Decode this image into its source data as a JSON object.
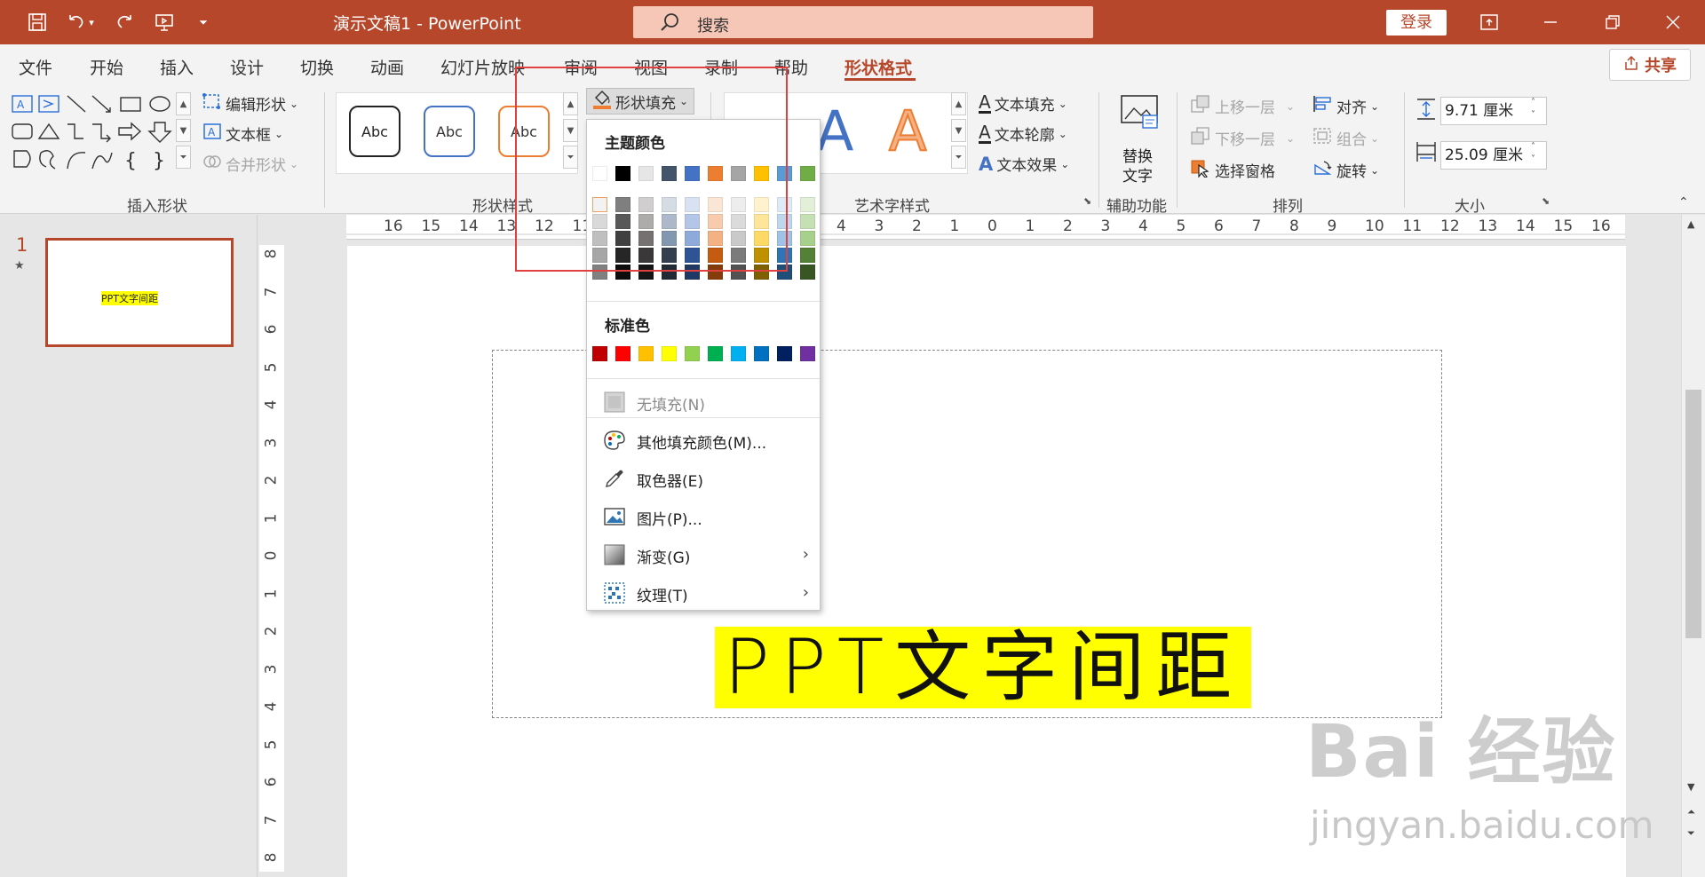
{
  "titlebar": {
    "doc_title": "演示文稿1  -  PowerPoint",
    "search_placeholder": "搜索",
    "login_label": "登录"
  },
  "tabs": [
    "文件",
    "开始",
    "插入",
    "设计",
    "切换",
    "动画",
    "幻灯片放映",
    "审阅",
    "视图",
    "录制",
    "帮助",
    "形状格式"
  ],
  "active_tab": "形状格式",
  "share_label": "共享",
  "ribbon": {
    "insert_shapes": {
      "label": "插入形状",
      "edit_shape": "编辑形状",
      "text_box": "文本框",
      "merge_shapes": "合并形状"
    },
    "shape_styles": {
      "label": "形状样式",
      "style_samples": [
        "Abc",
        "Abc",
        "Abc"
      ],
      "shape_fill": "形状填充"
    },
    "wordart": {
      "label": "艺术字样式",
      "text_fill": "文本填充",
      "text_outline": "文本轮廓",
      "text_effects": "文本效果"
    },
    "accessibility": {
      "label": "辅助功能",
      "alt_text_line1": "替换",
      "alt_text_line2": "文字"
    },
    "arrange": {
      "label": "排列",
      "bring_forward": "上移一层",
      "send_backward": "下移一层",
      "selection_pane": "选择窗格",
      "align": "对齐",
      "group": "组合",
      "rotate": "旋转"
    },
    "size": {
      "label": "大小",
      "height": "9.71 厘米",
      "width": "25.09 厘米"
    }
  },
  "thumbnail": {
    "slide_number": "1",
    "text": "PPT文字间距"
  },
  "slide": {
    "text": "PPT文字间距"
  },
  "hruler_labels": [
    "16",
    "15",
    "14",
    "13",
    "12",
    "11",
    "4",
    "3",
    "2",
    "1",
    "0",
    "1",
    "2",
    "3",
    "4",
    "5",
    "6",
    "7",
    "8",
    "9",
    "10",
    "11",
    "12",
    "13",
    "14",
    "15",
    "16"
  ],
  "vruler_labels": [
    "8",
    "7",
    "6",
    "5",
    "4",
    "3",
    "2",
    "1",
    "0",
    "1",
    "2",
    "3",
    "4",
    "5",
    "6",
    "7",
    "8"
  ],
  "dropdown": {
    "theme_colors_label": "主题颜色",
    "standard_colors_label": "标准色",
    "theme_top_row": [
      "#ffffff",
      "#000000",
      "#e7e6e6",
      "#44546a",
      "#4472c4",
      "#ed7d31",
      "#a5a5a5",
      "#ffc000",
      "#5b9bd5",
      "#70ad47"
    ],
    "theme_shades": [
      [
        "#f2f2f2",
        "#d9d9d9",
        "#bfbfbf",
        "#a6a6a6",
        "#808080"
      ],
      [
        "#7f7f7f",
        "#595959",
        "#404040",
        "#262626",
        "#0d0d0d"
      ],
      [
        "#d0cece",
        "#aeabab",
        "#757171",
        "#3a3838",
        "#171616"
      ],
      [
        "#d6dce4",
        "#adb9ca",
        "#8497b0",
        "#333f4f",
        "#222a35"
      ],
      [
        "#d9e2f3",
        "#b4c6e7",
        "#8eaadb",
        "#2f5496",
        "#1f3864"
      ],
      [
        "#fbe5d5",
        "#f7cbac",
        "#f4b183",
        "#c55a11",
        "#843c0b"
      ],
      [
        "#ededed",
        "#dbdbdb",
        "#c9c9c9",
        "#7b7b7b",
        "#525252"
      ],
      [
        "#fff2cc",
        "#ffe599",
        "#ffd966",
        "#bf9000",
        "#7f6000"
      ],
      [
        "#deebf6",
        "#bdd7ee",
        "#9dc3e6",
        "#2e75b5",
        "#1f4e79"
      ],
      [
        "#e2efd9",
        "#c5e0b3",
        "#a8d08d",
        "#538135",
        "#375623"
      ]
    ],
    "standard_colors": [
      "#c00000",
      "#ff0000",
      "#ffc000",
      "#ffff00",
      "#92d050",
      "#00b050",
      "#00b0f0",
      "#0070c0",
      "#002060",
      "#7030a0"
    ],
    "no_fill": "无填充(N)",
    "more_colors": "其他填充颜色(M)...",
    "eyedropper": "取色器(E)",
    "picture": "图片(P)...",
    "gradient": "渐变(G)",
    "texture": "纹理(T)"
  },
  "watermark": {
    "main": "Bai 经验",
    "sub": "jingyan.baidu.com"
  },
  "colors": {
    "accent": "#b7472a",
    "highlight": "#ffff00",
    "annotation": "#e04040"
  }
}
